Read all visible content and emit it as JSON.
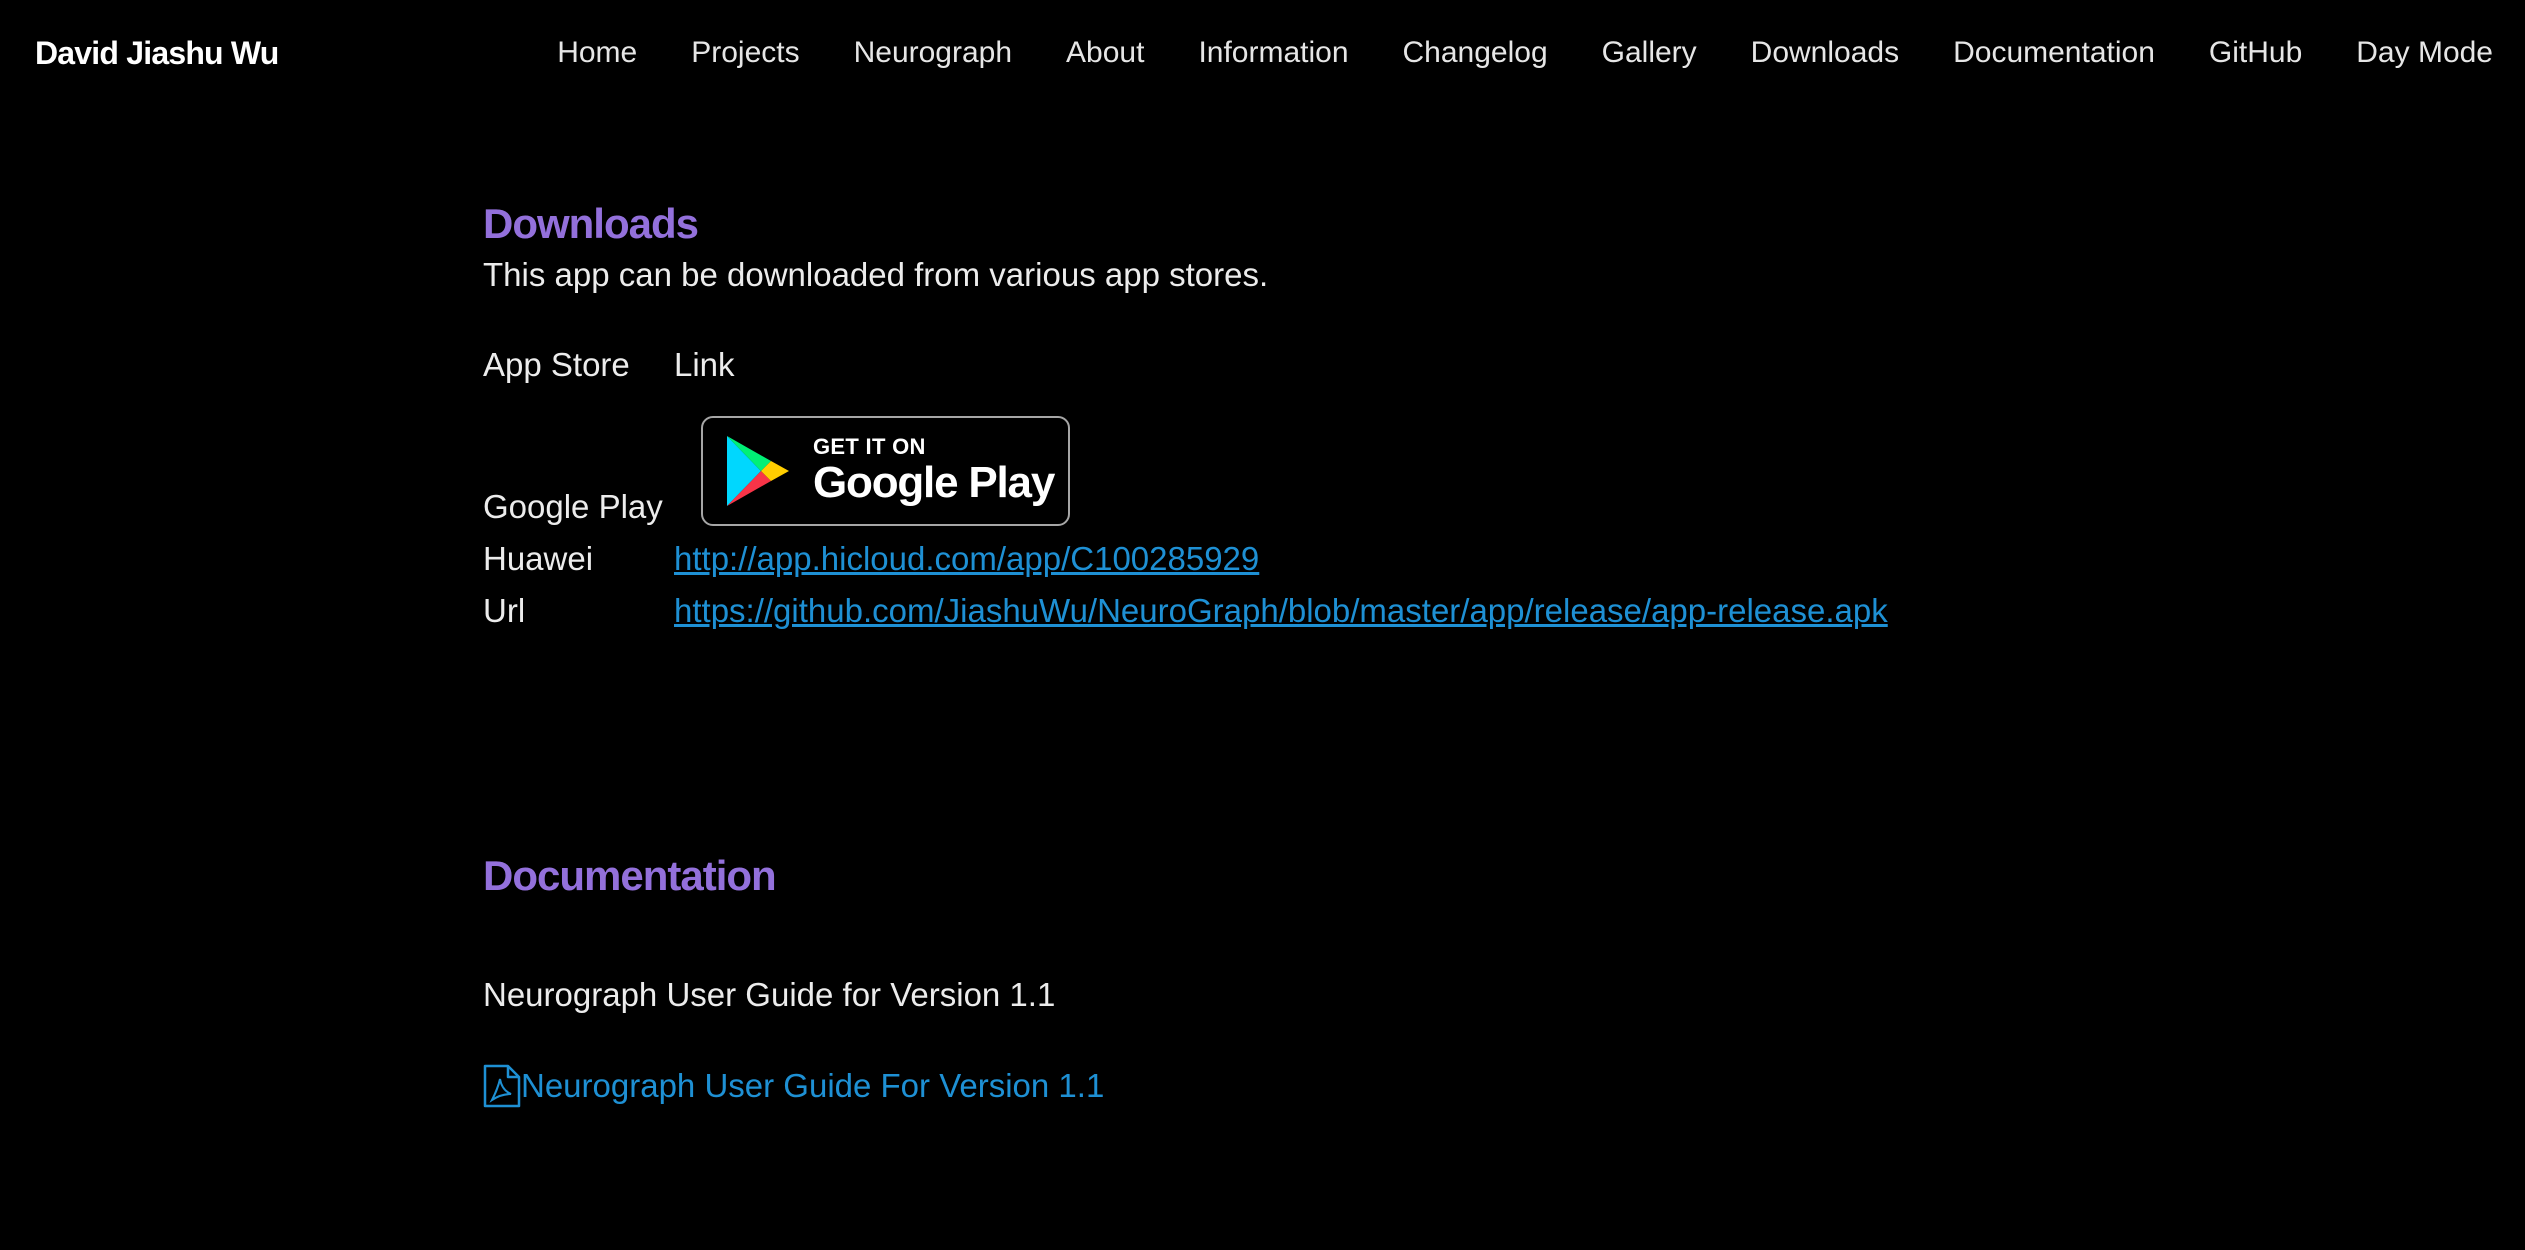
{
  "header": {
    "brand": "David Jiashu Wu",
    "nav": [
      "Home",
      "Projects",
      "Neurograph",
      "About",
      "Information",
      "Changelog",
      "Gallery",
      "Downloads",
      "Documentation",
      "GitHub",
      "Day Mode"
    ]
  },
  "downloads": {
    "title": "Downloads",
    "intro": "This app can be downloaded from various app stores.",
    "table_headers": [
      "App Store",
      "Link"
    ],
    "google_play": {
      "store": "Google Play",
      "badge_small": "GET IT ON",
      "badge_big": "Google Play"
    },
    "huawei": {
      "store": "Huawei",
      "url": "http://app.hicloud.com/app/C100285929"
    },
    "url_row": {
      "store": "Url",
      "url": "https://github.com/JiashuWu/NeuroGraph/blob/master/app/release/app-release.apk"
    }
  },
  "documentation": {
    "title": "Documentation",
    "guide_text": "Neurograph User Guide for Version 1.1",
    "pdf_link": "Neurograph User Guide For Version 1.1"
  },
  "colors": {
    "background": "#000000",
    "heading": "#9370db",
    "link": "#1e90d4",
    "text": "#ececec"
  }
}
